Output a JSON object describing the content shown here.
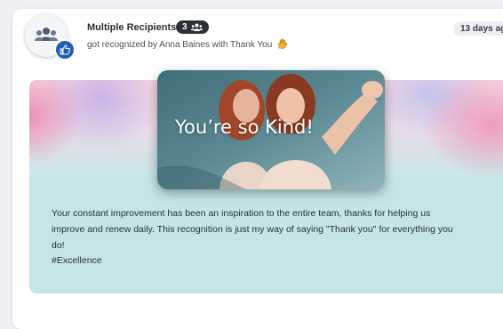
{
  "post": {
    "recipient_name": "Multiple Recipients",
    "recipient_count": "3",
    "recognized_line": "got recognized by Anna Baines with Thank You",
    "time_ago": "13 days ag",
    "card_caption": "You’re so Kind!",
    "message_lines": [
      "Your constant improvement has been an inspiration to the entire team, thanks for helping us",
      "improve and renew daily. This recognition is just my way of saying \"Thank you\" for everything you",
      "do!"
    ],
    "hashtag": "#Excellence"
  },
  "icons": {
    "avatar": "group-icon",
    "badge": "thumbs-up-icon",
    "count": "people-icon",
    "award": "clapping-hands-icon"
  },
  "colors": {
    "badge_blue": "#1f5fb4",
    "count_badge_bg": "#2c2f36",
    "panel_teal": "#c3e5e6"
  }
}
